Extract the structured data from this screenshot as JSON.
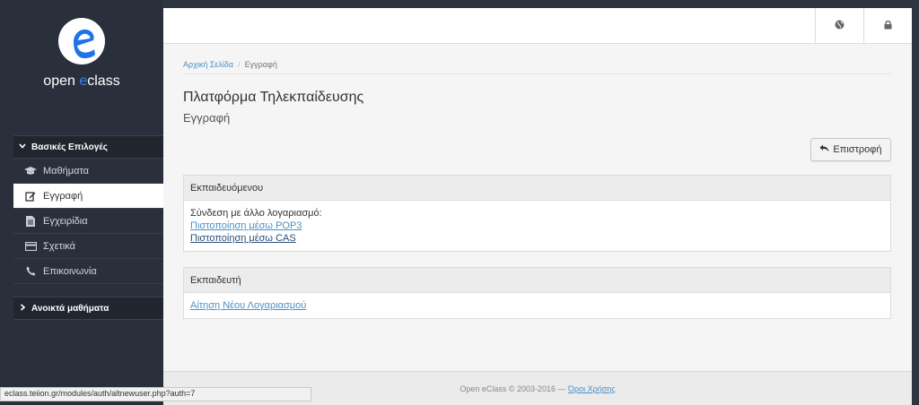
{
  "brand": {
    "name_prefix": "open ",
    "name_accent": "e",
    "name_suffix": "class"
  },
  "sidebar": {
    "section_basic": "Βασικές Επιλογές",
    "items": [
      {
        "label": "Μαθήματα",
        "icon": "graduation-cap-icon"
      },
      {
        "label": "Εγγραφή",
        "icon": "edit-icon",
        "active": true
      },
      {
        "label": "Εγχειρίδια",
        "icon": "document-icon"
      },
      {
        "label": "Σχετικά",
        "icon": "credit-card-icon"
      },
      {
        "label": "Επικοινωνία",
        "icon": "phone-icon"
      }
    ],
    "section_open": "Ανοικτά μαθήματα"
  },
  "topbar": {
    "language_icon": "globe-icon",
    "login_icon": "lock-icon"
  },
  "breadcrumb": {
    "home": "Αρχική Σελίδα",
    "separator": "/",
    "current": "Εγγραφή"
  },
  "page": {
    "title": "Πλατφόρμα Τηλεκπαίδευσης",
    "subtitle": "Εγγραφή"
  },
  "back_button": {
    "label": "Επιστροφή"
  },
  "panels": {
    "student": {
      "heading": "Εκπαιδευόμενου",
      "intro": "Σύνδεση με άλλο λογαριασμό:",
      "pop3": "Πιστοποίηση μέσω POP3",
      "cas": "Πιστοποίηση μέσω CAS"
    },
    "teacher": {
      "heading": "Εκπαιδευτή",
      "request": "Αίτηση Νέου Λογαριασμού"
    }
  },
  "footer": {
    "copyright": "Open eClass © 2003-2016 — ",
    "terms": "Όροι Χρήσης"
  },
  "statusbar": {
    "url": "eclass.teiion.gr/modules/auth/altnewuser.php?auth=7"
  },
  "colors": {
    "sidebar_bg": "#2a303b",
    "accent": "#3b82f6",
    "link": "#4a90c8"
  }
}
